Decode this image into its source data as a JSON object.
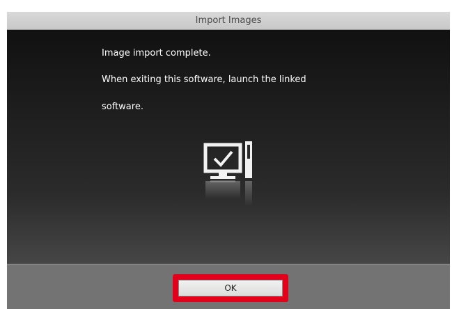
{
  "dialog": {
    "title": "Import Images",
    "message_lines": [
      "Image import complete.",
      "When exiting this software, launch the linked",
      "software."
    ],
    "icon": "computer-check-icon",
    "ok_label": "OK",
    "highlight_color": "#e2001a"
  }
}
